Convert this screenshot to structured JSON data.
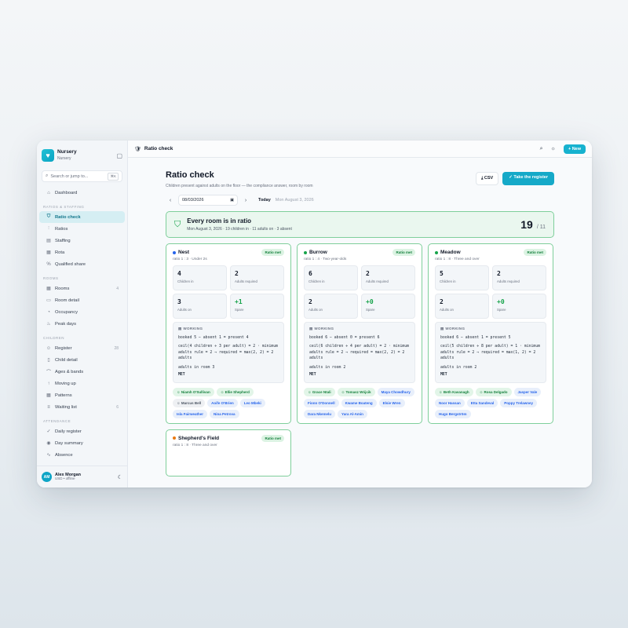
{
  "app": {
    "name": "Nursery",
    "sub": "Nursery"
  },
  "search": {
    "placeholder": "Search or jump to...",
    "kbd": "⌘K"
  },
  "nav": {
    "sections": [
      {
        "title": "",
        "items": [
          {
            "label": "Dashboard",
            "icon": "home-icon",
            "count": ""
          }
        ]
      },
      {
        "title": "RATIOS & STAFFING",
        "items": [
          {
            "label": "Ratio check",
            "icon": "shield-icon",
            "count": "",
            "active": true
          },
          {
            "label": "Ratios",
            "icon": "sliders-icon",
            "count": ""
          },
          {
            "label": "Staffing",
            "icon": "clipboard-icon",
            "count": ""
          },
          {
            "label": "Rota",
            "icon": "calendar-icon",
            "count": ""
          },
          {
            "label": "Qualified share",
            "icon": "percent-icon",
            "count": ""
          }
        ]
      },
      {
        "title": "ROOMS",
        "items": [
          {
            "label": "Rooms",
            "icon": "grid-icon",
            "count": "4"
          },
          {
            "label": "Room detail",
            "icon": "panel-icon",
            "count": ""
          },
          {
            "label": "Occupancy",
            "icon": "gauge-icon",
            "count": ""
          },
          {
            "label": "Peak days",
            "icon": "flame-icon",
            "count": ""
          }
        ]
      },
      {
        "title": "CHILDREN",
        "items": [
          {
            "label": "Register",
            "icon": "users-icon",
            "count": "28"
          },
          {
            "label": "Child detail",
            "icon": "file-icon",
            "count": ""
          },
          {
            "label": "Ages & bands",
            "icon": "cake-icon",
            "count": ""
          },
          {
            "label": "Moving up",
            "icon": "arrow-up-icon",
            "count": ""
          },
          {
            "label": "Patterns",
            "icon": "grid-icon",
            "count": ""
          },
          {
            "label": "Waiting list",
            "icon": "list-icon",
            "count": "6"
          }
        ]
      },
      {
        "title": "ATTENDANCE",
        "items": [
          {
            "label": "Daily register",
            "icon": "check-icon",
            "count": ""
          },
          {
            "label": "Day summary",
            "icon": "eye-icon",
            "count": ""
          },
          {
            "label": "Absence",
            "icon": "activity-icon",
            "count": ""
          }
        ]
      }
    ]
  },
  "user": {
    "initials": "AM",
    "name": "Alex Morgan",
    "sub": "USD • offline"
  },
  "topbar": {
    "title": "Ratio check",
    "new_label": "New"
  },
  "page": {
    "title": "Ratio check",
    "subtitle": "Children present against adults on the floor — the compliance answer, room by room",
    "csv_label": "CSV",
    "register_label": "Take the register",
    "date_value": "08/03/2026",
    "today_label": "Today",
    "today_date": "Mon August 3, 2026"
  },
  "banner": {
    "title": "Every room is in ratio",
    "sub": "Mon August 3, 2026 · 19 children in · 11 adults on · 3 absent",
    "children": "19",
    "adults": "11"
  },
  "rooms": [
    {
      "name": "Nest",
      "dot": "#2563eb",
      "sub": "ratio 1 : 3 · Under 2s",
      "badge": "Ratio met",
      "children_in": "4",
      "adults_required": "2",
      "adults_on": "3",
      "spare": "+1",
      "working": {
        "l1": "booked 5 − absent 1 = present 4",
        "l2": "ceil(4 children ÷ 3 per adult) = 2 · minimum adults rule = 2 → required = max(2, 2) = 2 adults",
        "l3": "adults in room 3",
        "met": "MET"
      },
      "staff": [
        "Niamh O'Sullivan",
        "Ellie Shepherd"
      ],
      "other": [
        "Marcus Bell"
      ],
      "children": [
        "Aoife O'Brien",
        "Leo Mbeki",
        "Isla Fairweather",
        "Nina Petrova"
      ]
    },
    {
      "name": "Burrow",
      "dot": "#16a34a",
      "sub": "ratio 1 : 4 · Two-year-olds",
      "badge": "Ratio met",
      "children_in": "6",
      "adults_required": "2",
      "adults_on": "2",
      "spare": "+0",
      "working": {
        "l1": "booked 6 − absent 0 = present 6",
        "l2": "ceil(6 children ÷ 4 per adult) = 2 · minimum adults rule = 2 → required = max(2, 2) = 2 adults",
        "l3": "adults in room 2",
        "met": "MET"
      },
      "staff": [
        "Grace Ntali",
        "Tomasz Wójcik"
      ],
      "other": [],
      "children": [
        "Maya Chowdhury",
        "Fionn O'Donnell",
        "Kwame Boateng",
        "Elsie Wren",
        "Dara Nkemelu",
        "Yara Al-Amin"
      ]
    },
    {
      "name": "Meadow",
      "dot": "#16a34a",
      "sub": "ratio 1 : 8 · Three and over",
      "badge": "Ratio met",
      "children_in": "5",
      "adults_required": "2",
      "adults_on": "2",
      "spare": "+0",
      "working": {
        "l1": "booked 6 − absent 1 = present 5",
        "l2": "ceil(5 children ÷ 8 per adult) = 1 · minimum adults rule = 2 → required = max(1, 2) = 2 adults",
        "l3": "adults in room 2",
        "met": "MET"
      },
      "staff": [
        "Beth Kavanagh",
        "Rosa Delgado"
      ],
      "other": [],
      "children": [
        "Jasper Vale",
        "Noor Hassan",
        "Etta Sandeval",
        "Poppy Trelawney",
        "Hugo Bergström"
      ]
    }
  ],
  "room4": {
    "name": "Shepherd's Field",
    "dot": "#ea7a12",
    "sub": "ratio 1 : 8 · Three and over",
    "badge": "Ratio met"
  },
  "labels": {
    "children_in": "Children in",
    "adults_required": "Adults required",
    "adults_on": "Adults on",
    "spare": "Spare",
    "working": "WORKING"
  },
  "colors": {
    "accent": "#16a9c8",
    "ok": "#16a34a"
  }
}
